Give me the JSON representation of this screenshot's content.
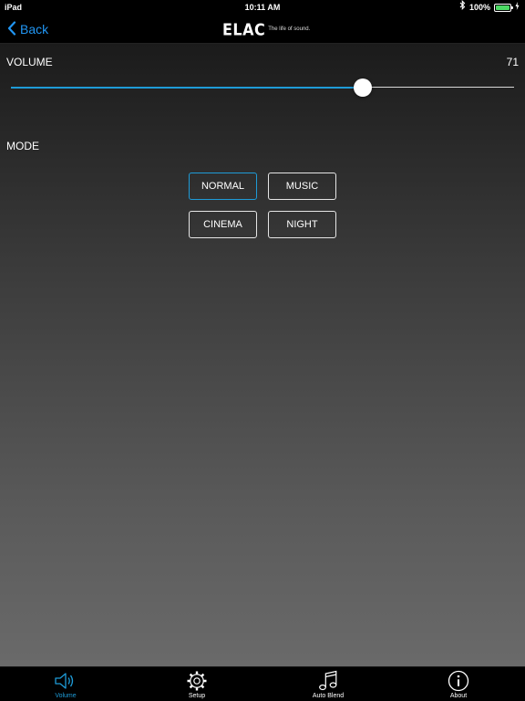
{
  "status_bar": {
    "device": "iPad",
    "time": "10:11 AM",
    "battery": "100%"
  },
  "nav": {
    "back_label": "Back",
    "brand": "ELAC",
    "tagline": "The life of sound."
  },
  "volume": {
    "label": "VOLUME",
    "value": "71",
    "level_fraction": 0.7
  },
  "mode": {
    "label": "MODE",
    "options": [
      "NORMAL",
      "MUSIC",
      "CINEMA",
      "NIGHT"
    ],
    "selected": "NORMAL"
  },
  "tabs": [
    {
      "label": "Volume",
      "icon": "speaker-icon",
      "active": true
    },
    {
      "label": "Setup",
      "icon": "gear-icon",
      "active": false
    },
    {
      "label": "Auto Blend",
      "icon": "music-note-icon",
      "active": false
    },
    {
      "label": "About",
      "icon": "info-icon",
      "active": false
    }
  ],
  "colors": {
    "accent": "#1e9bd7",
    "back_link": "#2196f3",
    "battery": "#4cd964"
  }
}
